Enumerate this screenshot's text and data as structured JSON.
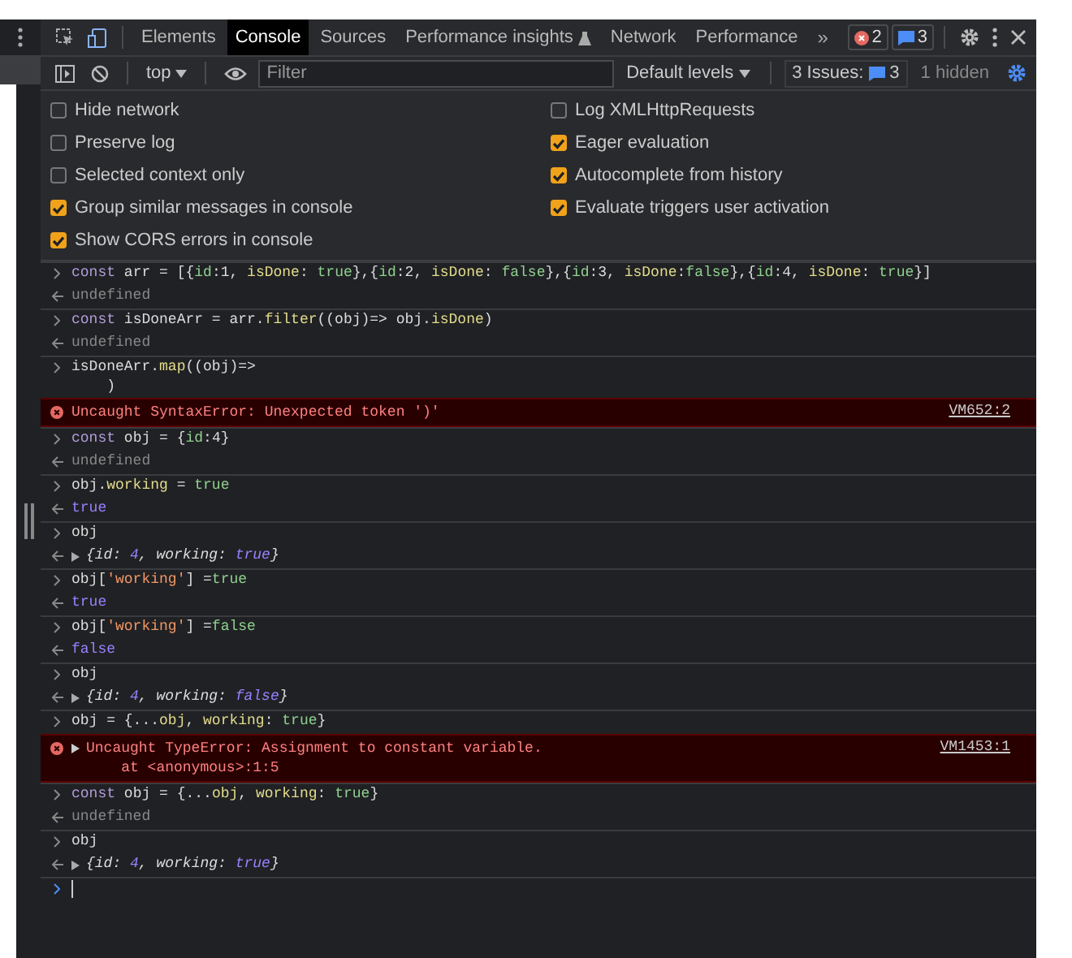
{
  "toolbar": {
    "tabs": [
      {
        "label": "Elements",
        "selected": false,
        "kind": "plain"
      },
      {
        "label": "Console",
        "selected": true,
        "kind": "plain"
      },
      {
        "label": "Sources",
        "selected": false,
        "kind": "plain"
      },
      {
        "label": "Performance insights",
        "selected": false,
        "kind": "experimental"
      },
      {
        "label": "Network",
        "selected": false,
        "kind": "plain"
      },
      {
        "label": "Performance",
        "selected": false,
        "kind": "plain"
      }
    ],
    "more": "»",
    "error_count": "2",
    "message_count": "3"
  },
  "console_bar": {
    "context": "top",
    "filter_placeholder": "Filter",
    "levels": "Default levels",
    "issues_label": "3 Issues:",
    "issues_count": "3",
    "hidden": "1 hidden"
  },
  "settings": [
    {
      "label": "Hide network",
      "checked": false
    },
    {
      "label": "Log XMLHttpRequests",
      "checked": false
    },
    {
      "label": "Preserve log",
      "checked": false
    },
    {
      "label": "Eager evaluation",
      "checked": true
    },
    {
      "label": "Selected context only",
      "checked": false
    },
    {
      "label": "Autocomplete from history",
      "checked": true
    },
    {
      "label": "Group similar messages in console",
      "checked": true
    },
    {
      "label": "Evaluate triggers user activation",
      "checked": true
    },
    {
      "label": "Show CORS errors in console",
      "checked": true
    }
  ],
  "console": [
    {
      "kind": "input",
      "lines": [
        "const arr = [{id:1, isDone: true},{id:2, isDone: false},{id:3, isDone:false},{id:4, isDone: true}]"
      ]
    },
    {
      "kind": "undefined",
      "text": "undefined"
    },
    {
      "kind": "input",
      "lines": [
        "const isDoneArr = arr.filter((obj)=> obj.isDone)"
      ]
    },
    {
      "kind": "undefined",
      "text": "undefined"
    },
    {
      "kind": "input",
      "lines": [
        "isDoneArr.map((obj)=>",
        "    )"
      ]
    },
    {
      "kind": "error",
      "lines": [
        "Uncaught SyntaxError: Unexpected token ')'"
      ],
      "source": "VM652:2",
      "expandable": false
    },
    {
      "kind": "input",
      "lines": [
        "const obj = {id:4}"
      ]
    },
    {
      "kind": "undefined",
      "text": "undefined"
    },
    {
      "kind": "input",
      "lines": [
        "obj.working = true"
      ]
    },
    {
      "kind": "value",
      "text": "true"
    },
    {
      "kind": "input",
      "lines": [
        "obj"
      ]
    },
    {
      "kind": "object",
      "text": "{id: 4, working: true}"
    },
    {
      "kind": "input",
      "lines": [
        "obj['working'] =true"
      ]
    },
    {
      "kind": "value",
      "text": "true"
    },
    {
      "kind": "input",
      "lines": [
        "obj['working'] =false"
      ]
    },
    {
      "kind": "value",
      "text": "false"
    },
    {
      "kind": "input",
      "lines": [
        "obj"
      ]
    },
    {
      "kind": "object",
      "text": "{id: 4, working: false}"
    },
    {
      "kind": "input",
      "lines": [
        "obj = {...obj, working: true}"
      ]
    },
    {
      "kind": "error",
      "lines": [
        "Uncaught TypeError: Assignment to constant variable.",
        "    at <anonymous>:1:5"
      ],
      "source": "VM1453:1",
      "expandable": true
    },
    {
      "kind": "input",
      "lines": [
        "const obj = {...obj, working: true}"
      ]
    },
    {
      "kind": "undefined",
      "text": "undefined"
    },
    {
      "kind": "input",
      "lines": [
        "obj"
      ]
    },
    {
      "kind": "object",
      "text": "{id: 4, working: true}"
    },
    {
      "kind": "prompt"
    }
  ]
}
